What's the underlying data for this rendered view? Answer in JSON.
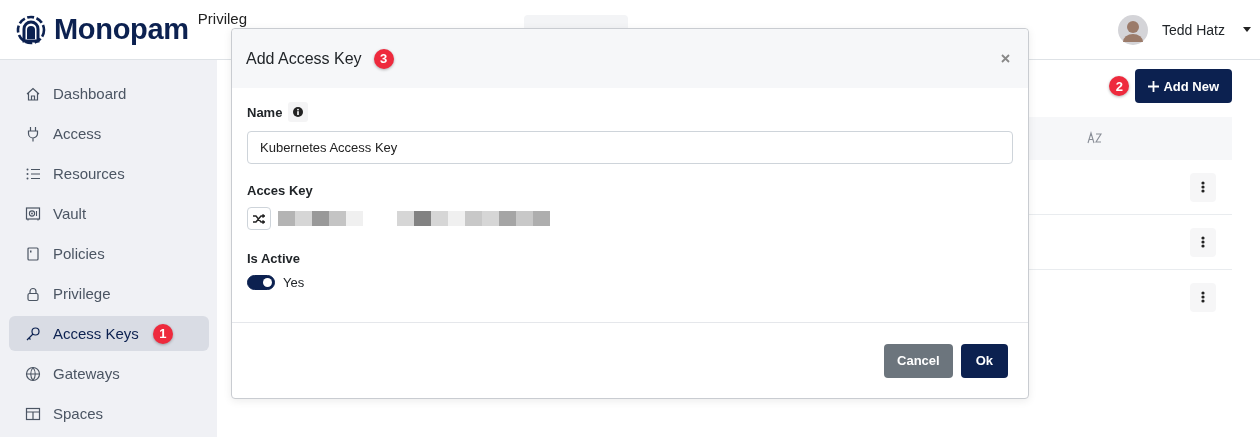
{
  "header": {
    "brand": "Monopam",
    "subtitle": "Privileg",
    "user_name": "Tedd Hatz"
  },
  "sidebar": {
    "items": [
      {
        "label": "Dashboard",
        "selected": false
      },
      {
        "label": "Access",
        "selected": false
      },
      {
        "label": "Resources",
        "selected": false
      },
      {
        "label": "Vault",
        "selected": false
      },
      {
        "label": "Policies",
        "selected": false
      },
      {
        "label": "Privilege",
        "selected": false
      },
      {
        "label": "Access Keys",
        "selected": true,
        "badge": "1"
      },
      {
        "label": "Gateways",
        "selected": false
      },
      {
        "label": "Spaces",
        "selected": false
      }
    ]
  },
  "toolbar": {
    "badge": "2",
    "add_button": "Add New"
  },
  "table": {
    "rows": [
      {
        "kind": "actions"
      },
      {
        "kind": "actions"
      },
      {
        "kind": "actions"
      }
    ]
  },
  "modal": {
    "title": "Add Access Key",
    "badge": "3",
    "fields": [
      {
        "kind": "text",
        "label": "Name",
        "info": true,
        "value": "Kubernetes Access Key"
      },
      {
        "kind": "key",
        "label": "Acces Key"
      },
      {
        "kind": "toggle",
        "label": "Is Active",
        "on": true,
        "text": "Yes"
      }
    ],
    "buttons": [
      {
        "label": "Cancel",
        "kind": "secondary"
      },
      {
        "label": "Ok",
        "kind": "primary"
      }
    ]
  }
}
